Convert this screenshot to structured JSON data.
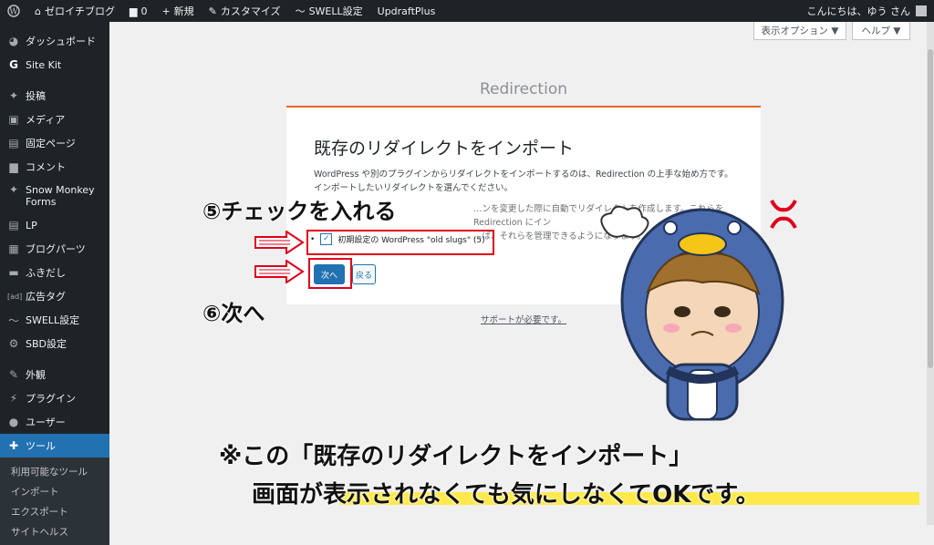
{
  "admin_bar": {
    "site_name": "ゼロイチブログ",
    "comments_count": "0",
    "new_label": "新規",
    "customize_label": "カスタマイズ",
    "swell_label": "SWELL設定",
    "updraft_label": "UpdraftPlus",
    "greeting": "こんにちは、ゆう さん"
  },
  "sidebar": {
    "items": [
      {
        "icon": "dashboard-icon",
        "label": "ダッシュボード"
      },
      {
        "icon": "sitekit-icon",
        "label": "Site Kit"
      },
      {
        "icon": "pin-icon",
        "label": "投稿"
      },
      {
        "icon": "media-icon",
        "label": "メディア"
      },
      {
        "icon": "page-icon",
        "label": "固定ページ"
      },
      {
        "icon": "comment-icon",
        "label": "コメント"
      },
      {
        "icon": "pin-icon",
        "label": "Snow Monkey Forms"
      },
      {
        "icon": "page-icon",
        "label": "LP"
      },
      {
        "icon": "blocks-icon",
        "label": "ブログパーツ"
      },
      {
        "icon": "balloon-icon",
        "label": "ふきだし"
      },
      {
        "icon": "ad-icon",
        "label": "広告タグ"
      },
      {
        "icon": "swell-icon",
        "label": "SWELL設定"
      },
      {
        "icon": "gear-icon",
        "label": "SBD設定"
      },
      {
        "icon": "brush-icon",
        "label": "外観"
      },
      {
        "icon": "plugin-icon",
        "label": "プラグイン"
      },
      {
        "icon": "user-icon",
        "label": "ユーザー"
      },
      {
        "icon": "wrench-icon",
        "label": "ツール"
      }
    ],
    "submenu": [
      "利用可能なツール",
      "インポート",
      "エクスポート",
      "サイトヘルス"
    ]
  },
  "screen_options_label": "表示オプション ▼",
  "help_label": "ヘルプ ▼",
  "plugin_title": "Redirection",
  "card": {
    "heading": "既存のリダイレクトをインポート",
    "para1_line1": "WordPress や別のプラグインからリダイレクトをインポートするのは、Redirection の上手な始め方です。",
    "para1_line2": "インポートしたいリダイレクトを選んでください。",
    "para2_line1": "…ンを変更した際に自動でリダイレクトを作成します。これらを Redirection にイン",
    "para2_line2": "…ば、それらを管理できるようになります。",
    "option_label": "初期設定の WordPress \"old slugs\" (5)",
    "next_button": "次へ",
    "back_button": "戻る"
  },
  "support_link": "サポートが必要です。",
  "annotations": {
    "step5": "⑤チェックを入れる",
    "step6": "⑥次へ",
    "note_line1": "※この「既存のリダイレクトをインポート」",
    "note_line2": "画面が表示されなくても気にしなくてOKです。"
  },
  "colors": {
    "admin_dark": "#1d2327",
    "wp_blue": "#2271b1",
    "accent_orange": "#e2682a",
    "annotation_red": "#e0001a",
    "highlight_yellow": "#ffe94a"
  }
}
